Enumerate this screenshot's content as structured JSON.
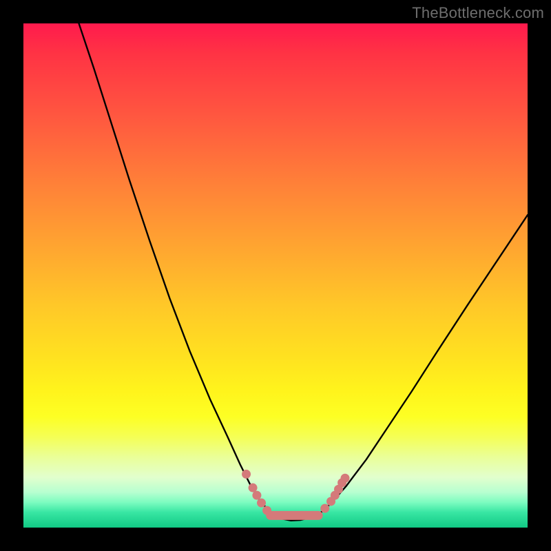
{
  "watermark": "TheBottleneck.com",
  "chart_data": {
    "type": "line",
    "title": "",
    "xlabel": "",
    "ylabel": "",
    "xlim": [
      0,
      100
    ],
    "ylim": [
      0,
      100
    ],
    "series": [
      {
        "name": "bottleneck-curve",
        "color": "#000000",
        "points": [
          {
            "x": 11.0,
            "y": 100.0
          },
          {
            "x": 14.0,
            "y": 91.0
          },
          {
            "x": 17.5,
            "y": 80.0
          },
          {
            "x": 21.0,
            "y": 69.0
          },
          {
            "x": 25.0,
            "y": 57.0
          },
          {
            "x": 29.0,
            "y": 45.5
          },
          {
            "x": 33.0,
            "y": 35.0
          },
          {
            "x": 37.0,
            "y": 25.5
          },
          {
            "x": 40.5,
            "y": 18.0
          },
          {
            "x": 43.0,
            "y": 12.5
          },
          {
            "x": 45.0,
            "y": 8.5
          },
          {
            "x": 47.0,
            "y": 5.2
          },
          {
            "x": 49.0,
            "y": 3.0
          },
          {
            "x": 51.0,
            "y": 1.8
          },
          {
            "x": 53.0,
            "y": 1.4
          },
          {
            "x": 55.0,
            "y": 1.5
          },
          {
            "x": 57.0,
            "y": 2.0
          },
          {
            "x": 59.0,
            "y": 3.0
          },
          {
            "x": 61.0,
            "y": 4.8
          },
          {
            "x": 64.0,
            "y": 8.2
          },
          {
            "x": 68.0,
            "y": 13.5
          },
          {
            "x": 72.0,
            "y": 19.5
          },
          {
            "x": 77.0,
            "y": 27.0
          },
          {
            "x": 82.0,
            "y": 34.8
          },
          {
            "x": 88.0,
            "y": 44.0
          },
          {
            "x": 94.0,
            "y": 53.0
          },
          {
            "x": 100.0,
            "y": 62.0
          }
        ]
      },
      {
        "name": "optimal-markers-left",
        "color": "#d47a7a",
        "points": [
          {
            "x": 44.2,
            "y": 10.6
          },
          {
            "x": 45.5,
            "y": 7.9
          },
          {
            "x": 46.3,
            "y": 6.4
          },
          {
            "x": 47.2,
            "y": 4.9
          },
          {
            "x": 48.3,
            "y": 3.4
          }
        ]
      },
      {
        "name": "optimal-markers-right",
        "color": "#d47a7a",
        "points": [
          {
            "x": 59.8,
            "y": 3.8
          },
          {
            "x": 61.0,
            "y": 5.2
          },
          {
            "x": 61.8,
            "y": 6.4
          },
          {
            "x": 62.5,
            "y": 7.6
          },
          {
            "x": 63.2,
            "y": 8.9
          },
          {
            "x": 63.8,
            "y": 9.8
          }
        ]
      },
      {
        "name": "optimal-band",
        "color": "#d47a7a",
        "type_override": "line-thick",
        "points": [
          {
            "x": 49.0,
            "y": 2.4
          },
          {
            "x": 58.5,
            "y": 2.4
          }
        ]
      }
    ],
    "gradient_stops": [
      {
        "pos": 0.0,
        "color": "#ff1a4d"
      },
      {
        "pos": 0.32,
        "color": "#ff8138"
      },
      {
        "pos": 0.66,
        "color": "#ffe120"
      },
      {
        "pos": 0.86,
        "color": "#eaff98"
      },
      {
        "pos": 1.0,
        "color": "#11c984"
      }
    ]
  }
}
